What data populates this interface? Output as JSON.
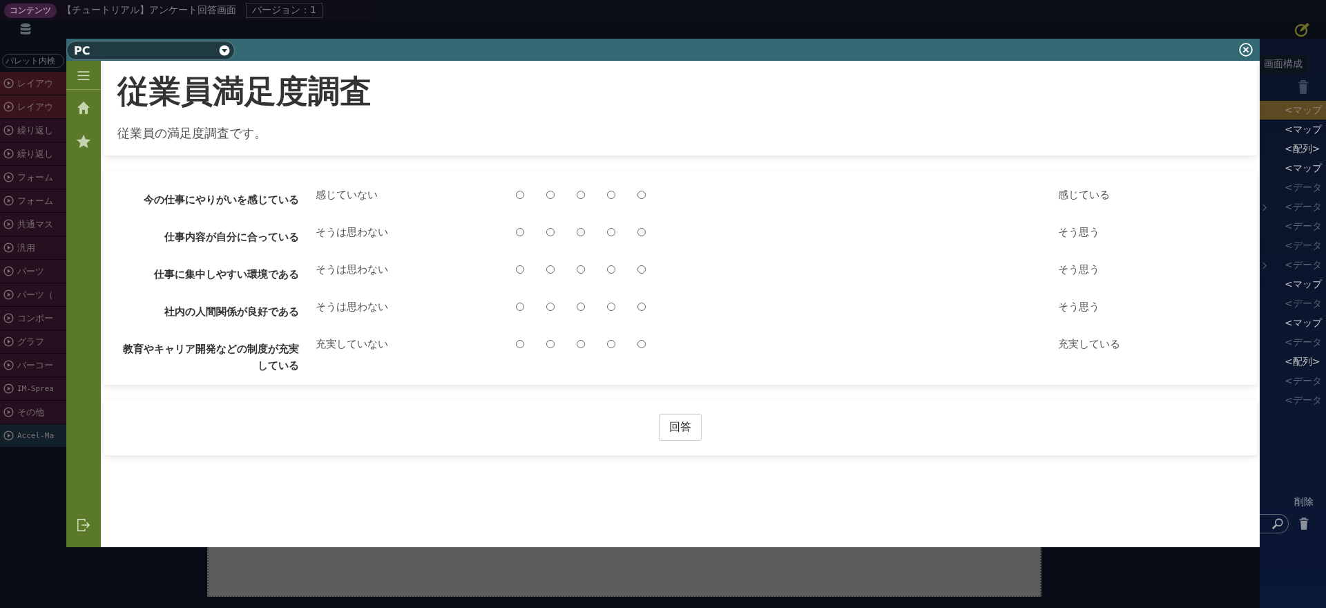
{
  "topbar": {
    "tag": "コンテンツ",
    "title": "【チュートリアル】アンケート回答画面",
    "version": "バージョン：1"
  },
  "palette": {
    "search_placeholder": "パレット内検",
    "items": [
      {
        "label": "レイアウ",
        "kind": "layout"
      },
      {
        "label": "レイアウ",
        "kind": "layout"
      },
      {
        "label": "繰り返し",
        "kind": "normal"
      },
      {
        "label": "繰り返し",
        "kind": "normal"
      },
      {
        "label": "フォーム",
        "kind": "normal"
      },
      {
        "label": "フォーム",
        "kind": "normal"
      },
      {
        "label": "共通マス",
        "kind": "normal"
      },
      {
        "label": "汎用",
        "kind": "normal"
      },
      {
        "label": "パーツ",
        "kind": "normal"
      },
      {
        "label": "パーツ（",
        "kind": "normal"
      },
      {
        "label": "コンポー",
        "kind": "normal"
      },
      {
        "label": "グラフ",
        "kind": "normal"
      },
      {
        "label": "バーコー",
        "kind": "normal"
      },
      {
        "label": "IM-Sprea",
        "kind": "mono"
      },
      {
        "label": "その他",
        "kind": "normal"
      },
      {
        "label": "Accel-Ma",
        "kind": "mono-teal"
      }
    ]
  },
  "right_panel": {
    "tab": "画面構成",
    "rows": [
      {
        "label": "<マップ",
        "selected": true,
        "disabled": false,
        "expandable": false
      },
      {
        "label": "<マップ",
        "selected": false,
        "disabled": false,
        "expandable": false
      },
      {
        "label": "<配列>",
        "selected": false,
        "disabled": false,
        "expandable": false
      },
      {
        "label": "<マップ",
        "selected": false,
        "disabled": false,
        "expandable": false
      },
      {
        "label": "<データ",
        "selected": false,
        "disabled": true,
        "expandable": false
      },
      {
        "label": "<データ",
        "selected": false,
        "disabled": true,
        "expandable": true
      },
      {
        "label": "<データ",
        "selected": false,
        "disabled": true,
        "expandable": false
      },
      {
        "label": "<データ",
        "selected": false,
        "disabled": true,
        "expandable": false
      },
      {
        "label": "<データ",
        "selected": false,
        "disabled": true,
        "expandable": true
      },
      {
        "label": "<マップ",
        "selected": false,
        "disabled": false,
        "expandable": false
      },
      {
        "label": "<データ",
        "selected": false,
        "disabled": true,
        "expandable": false
      },
      {
        "label": "<マップ",
        "selected": false,
        "disabled": false,
        "expandable": false
      },
      {
        "label": "<データ",
        "selected": false,
        "disabled": true,
        "expandable": false
      },
      {
        "label": "<配列>",
        "selected": false,
        "disabled": false,
        "expandable": false
      },
      {
        "label": "<データ",
        "selected": false,
        "disabled": true,
        "expandable": false
      },
      {
        "label": "<データ",
        "selected": false,
        "disabled": true,
        "expandable": false
      }
    ],
    "delete_label": "削除"
  },
  "modal": {
    "device": "PC",
    "title": "従業員満足度調査",
    "description": "従業員の満足度調査です。",
    "questions": [
      {
        "label": "今の仕事にやりがいを感じている",
        "low": "感じていない",
        "high": "感じている",
        "choices": [
          {
            "selected": false
          },
          {
            "selected": false
          },
          {
            "selected": false
          },
          {
            "selected": false
          },
          {
            "selected": false
          }
        ]
      },
      {
        "label": "仕事内容が自分に合っている",
        "low": "そうは思わない",
        "high": "そう思う",
        "choices": [
          {
            "selected": false
          },
          {
            "selected": false
          },
          {
            "selected": false
          },
          {
            "selected": false
          },
          {
            "selected": false
          }
        ]
      },
      {
        "label": "仕事に集中しやすい環境である",
        "low": "そうは思わない",
        "high": "そう思う",
        "choices": [
          {
            "selected": false
          },
          {
            "selected": false
          },
          {
            "selected": false
          },
          {
            "selected": false
          },
          {
            "selected": false
          }
        ]
      },
      {
        "label": "社内の人間関係が良好である",
        "low": "そうは思わない",
        "high": "そう思う",
        "choices": [
          {
            "selected": false
          },
          {
            "selected": false
          },
          {
            "selected": false
          },
          {
            "selected": false
          },
          {
            "selected": false
          }
        ]
      },
      {
        "label": "教育やキャリア開発などの制度が充実している",
        "low": "充実していない",
        "high": "充実している",
        "choices": [
          {
            "selected": false
          },
          {
            "selected": false
          },
          {
            "selected": false
          },
          {
            "selected": false
          },
          {
            "selected": false
          }
        ]
      }
    ],
    "submit": "回答"
  }
}
